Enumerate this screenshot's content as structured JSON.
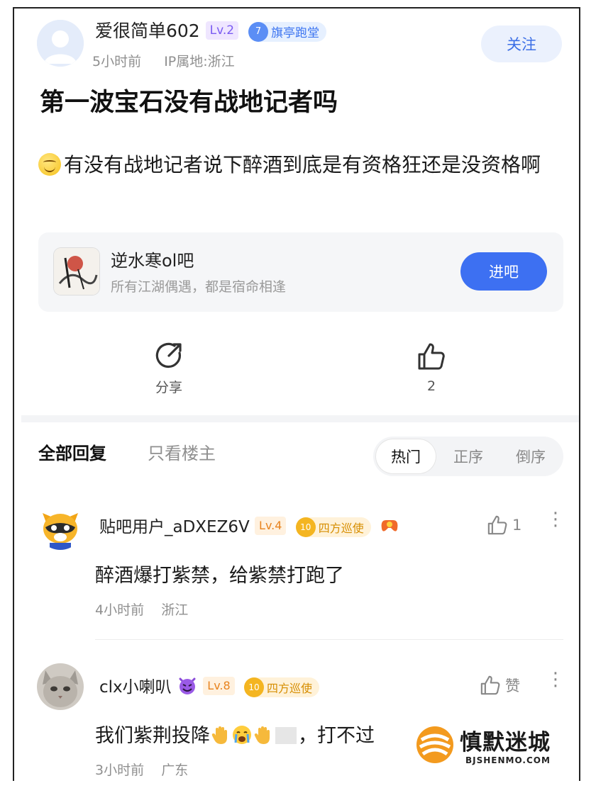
{
  "post": {
    "author": "爱很简单602",
    "author_level": "Lv.2",
    "badge_number": "7",
    "badge_label": "旗亭跑堂",
    "time": "5小时前",
    "ip": "IP属地:浙江",
    "follow_label": "关注",
    "title": "第一波宝石没有战地记者吗",
    "content": "有没有战地记者说下醉酒到底是有资格狂还是没资格啊"
  },
  "forum": {
    "name": "逆水寒ol吧",
    "description": "所有江湖偶遇，都是宿命相逢",
    "enter_label": "进吧",
    "logo_text": "逆水寒"
  },
  "actions": {
    "share_label": "分享",
    "like_count": "2"
  },
  "replies": {
    "tab_all": "全部回复",
    "tab_owner": "只看楼主",
    "sort_options": [
      "热门",
      "正序",
      "倒序"
    ],
    "active_sort": "热门"
  },
  "comments": [
    {
      "author": "贴吧用户_aDXEZ6V",
      "level": "Lv.4",
      "badge_number": "10",
      "badge_label": "四方巡使",
      "text": "醉酒爆打紫禁，给紫禁打跑了",
      "time": "4小时前",
      "location": "浙江",
      "likes": "1"
    },
    {
      "author": "clx小喇叭",
      "level": "Lv.8",
      "badge_number": "10",
      "badge_label": "四方巡使",
      "text_before": "我们紫荆投降",
      "text_after": "，打不过",
      "time": "3小时前",
      "location": "广东",
      "likes": "赞"
    }
  ],
  "watermark": {
    "name": "慎默迷城",
    "domain": "BJSHENMO.COM"
  },
  "colors": {
    "accent": "#3d70f2",
    "follow_bg": "#ebf1fd",
    "level_purple": "#7a5cf2",
    "level_orange": "#e8831e",
    "badge_blue": "#3c74f0",
    "badge_gold": "#d68d00"
  },
  "icons": [
    "share-icon",
    "thumbs-up-icon",
    "more-vertical-icon",
    "smile-emoji-icon",
    "devil-emoji-icon",
    "raised-hand-emoji-icon",
    "crying-emoji-icon",
    "gamepad-badge-icon"
  ]
}
